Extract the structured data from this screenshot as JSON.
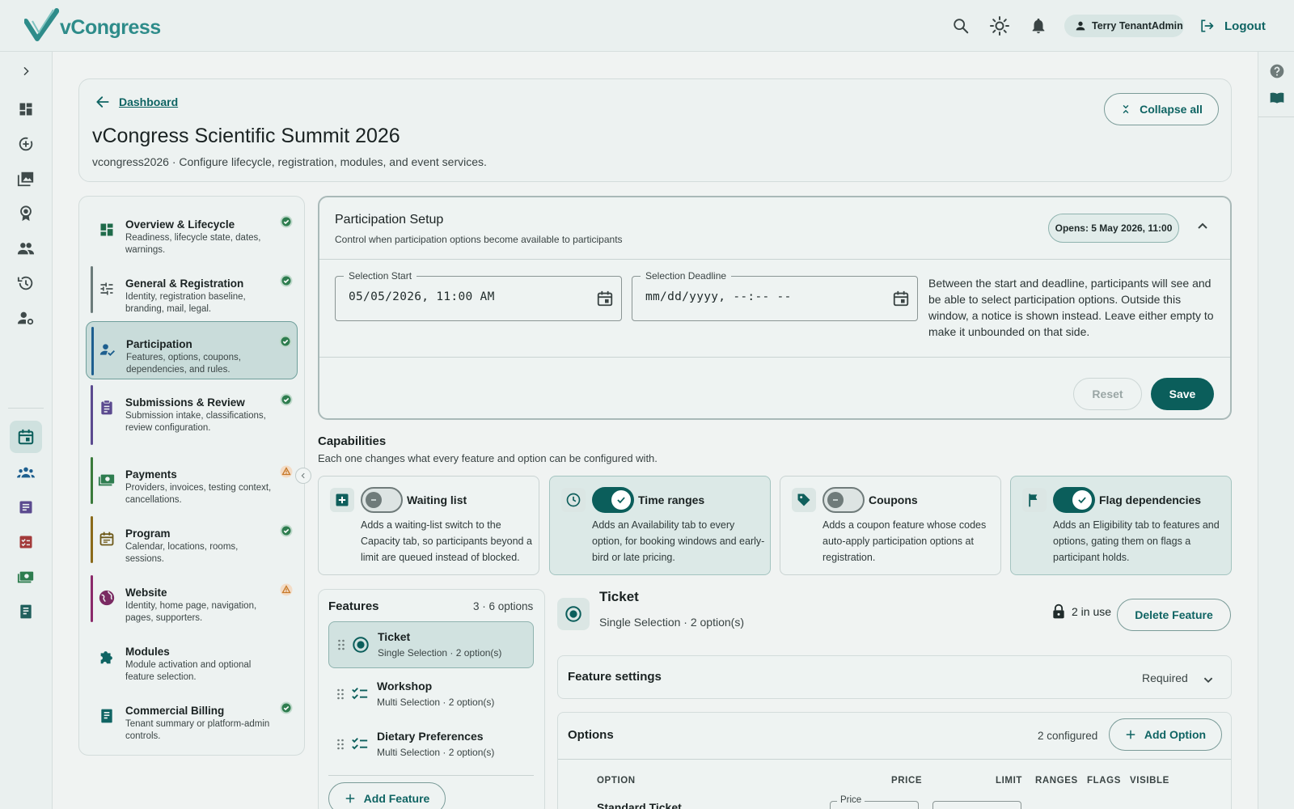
{
  "topbar": {
    "logo_text": "vCongress",
    "user_name": "Terry TenantAdmin",
    "logout_label": "Logout",
    "icons": [
      "search-icon",
      "theme-sun-icon",
      "bell-icon",
      "user-icon",
      "logout-icon"
    ]
  },
  "rail": {
    "icons": [
      "dashboard-icon",
      "lifecycle-icon",
      "gallery-icon",
      "award-icon",
      "people-icon",
      "history-icon",
      "user-settings-icon",
      "calendar-icon",
      "groups-icon",
      "article-icon",
      "checklist-icon",
      "payments-icon",
      "receipt-icon"
    ],
    "active": "calendar-icon"
  },
  "header": {
    "back_label": "Dashboard",
    "title": "vCongress Scientific Summit 2026",
    "subtitle": "vcongress2026 · Configure lifecycle, registration, modules, and event services.",
    "collapse_label": "Collapse all"
  },
  "nav": {
    "items": [
      {
        "title": "Overview & Lifecycle",
        "desc": "Readiness, lifecycle state, dates, warnings.",
        "status": "ok",
        "color": "#1f6b4a"
      },
      {
        "title": "General & Registration",
        "desc": "Identity, registration baseline, branding, mail, legal.",
        "status": "ok",
        "color": "#6b7b7a"
      },
      {
        "title": "Participation",
        "desc": "Features, options, coupons, dependencies, and rules.",
        "status": "ok",
        "color": "#1e5f8f"
      },
      {
        "title": "Submissions & Review",
        "desc": "Submission intake, classifications, review configuration.",
        "status": "ok",
        "color": "#5b4a8f"
      },
      {
        "title": "Payments",
        "desc": "Providers, invoices, testing context, cancellations.",
        "status": "warn",
        "color": "#3a7a3a"
      },
      {
        "title": "Program",
        "desc": "Calendar, locations, rooms, sessions.",
        "status": "ok",
        "color": "#8a6a1a"
      },
      {
        "title": "Website",
        "desc": "Identity, home page, navigation, pages, supporters.",
        "status": "warn",
        "color": "#8a2a6a"
      },
      {
        "title": "Modules",
        "desc": "Module activation and optional feature selection.",
        "status": "none",
        "color": "#0f6463"
      },
      {
        "title": "Commercial Billing",
        "desc": "Tenant summary or platform-admin controls.",
        "status": "ok",
        "color": "#0f6463"
      }
    ]
  },
  "setup": {
    "title": "Participation Setup",
    "desc": "Control when participation options become available to participants",
    "opens_badge": "Opens: 5 May 2026, 11:00",
    "start_label": "Selection Start",
    "start_value": "05/05/2026, 11:00 AM",
    "deadline_label": "Selection Deadline",
    "deadline_value": "mm/dd/yyyy, --:-- --",
    "help": "Between the start and deadline, participants will see and be able to select participation options. Outside this window, a notice is shown instead. Leave either empty to make it unbounded on that side.",
    "reset_label": "Reset",
    "save_label": "Save"
  },
  "capabilities": {
    "title": "Capabilities",
    "desc": "Each one changes what every feature and option can be configured with.",
    "items": [
      {
        "title": "Waiting list",
        "desc": "Adds a waiting-list switch to the Capacity tab, so participants beyond a limit are queued instead of blocked.",
        "enabled": false
      },
      {
        "title": "Time ranges",
        "desc": "Adds an Availability tab to every option, for booking windows and early-bird or late pricing.",
        "enabled": true
      },
      {
        "title": "Coupons",
        "desc": "Adds a coupon feature whose codes auto-apply participation options at registration.",
        "enabled": false
      },
      {
        "title": "Flag dependencies",
        "desc": "Adds an Eligibility tab to features and options, gating them on flags a participant holds.",
        "enabled": true
      }
    ]
  },
  "features": {
    "title": "Features",
    "count": "3 · 6 options",
    "items": [
      {
        "name": "Ticket",
        "sub": "Single Selection · 2 option(s)"
      },
      {
        "name": "Workshop",
        "sub": "Multi Selection · 2 option(s)"
      },
      {
        "name": "Dietary Preferences",
        "sub": "Multi Selection · 2 option(s)"
      }
    ],
    "add_label": "Add Feature"
  },
  "detail": {
    "title": "Ticket",
    "sub": "Single Selection · 2 option(s)",
    "in_use": "2 in use",
    "delete_label": "Delete Feature",
    "settings_title": "Feature settings",
    "settings_value": "Required",
    "options_title": "Options",
    "options_count": "2 configured",
    "add_option_label": "Add Option",
    "columns": [
      "OPTION",
      "PRICE",
      "LIMIT",
      "RANGES",
      "FLAGS",
      "VISIBLE"
    ],
    "first_row_name": "Standard Ticket",
    "price_label": "Price"
  },
  "colors": {
    "accent": "#0b5e5b",
    "ok": "#2e7d4f",
    "warn": "#c77a2a"
  }
}
